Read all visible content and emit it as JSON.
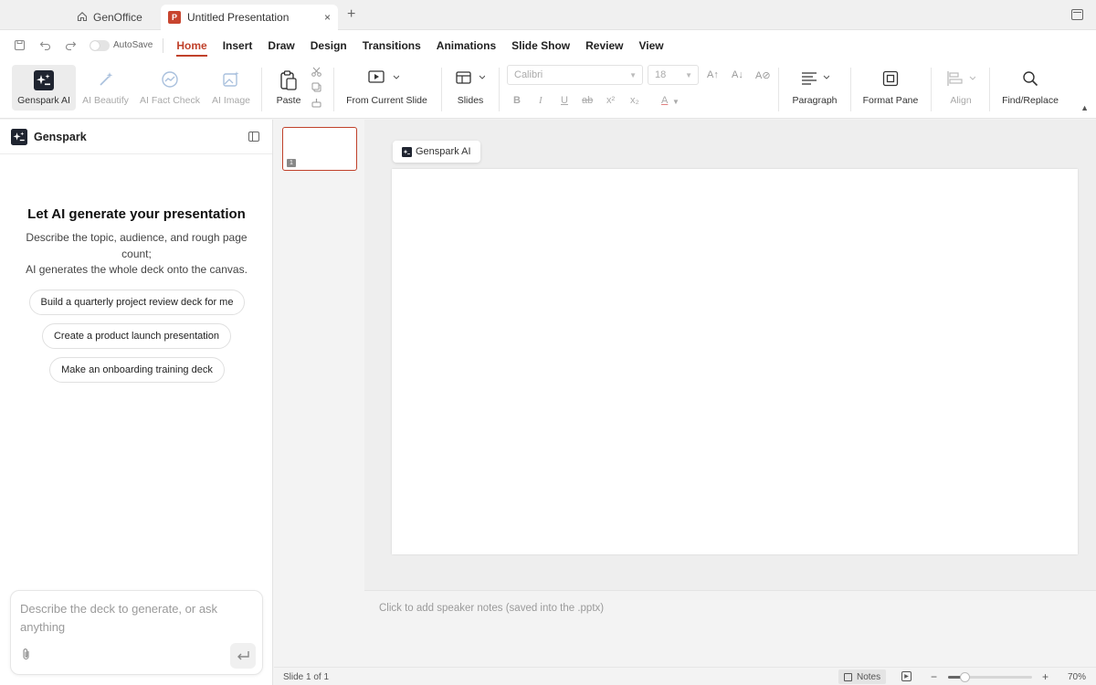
{
  "tabs": {
    "home_label": "GenOffice",
    "active_label": "Untitled Presentation",
    "active_badge": "P",
    "close_glyph": "×",
    "add_glyph": "+"
  },
  "menubar": {
    "autosave_label": "AutoSave",
    "items": [
      "Home",
      "Insert",
      "Draw",
      "Design",
      "Transitions",
      "Animations",
      "Slide Show",
      "Review",
      "View"
    ],
    "active_item": "Home"
  },
  "ribbon": {
    "genspark_ai": "Genspark AI",
    "ai_beautify": "AI Beautify",
    "ai_fact_check": "AI Fact Check",
    "ai_image": "AI Image",
    "paste": "Paste",
    "from_current_slide": "From Current Slide",
    "slides": "Slides",
    "font_name": "Calibri",
    "font_size": "18",
    "bold": "B",
    "italic": "I",
    "underline": "U",
    "strike": "ab",
    "superscript": "x²",
    "subscript": "x₂",
    "font_color": "A",
    "paragraph": "Paragraph",
    "format_pane": "Format Pane",
    "align": "Align",
    "find_replace": "Find/Replace"
  },
  "left_panel": {
    "title": "Genspark",
    "hero_title": "Let AI generate your presentation",
    "hero_desc_1": "Describe the topic, audience, and rough page count;",
    "hero_desc_2": "AI generates the whole deck onto the canvas.",
    "suggestions": [
      "Build a quarterly project review deck for me",
      "Create a product launch presentation",
      "Make an onboarding training deck"
    ],
    "composer_placeholder": "Describe the deck to generate, or ask anything"
  },
  "thumbnails": {
    "slide_number": "1"
  },
  "canvas": {
    "ai_chip_label": "Genspark AI"
  },
  "notes": {
    "placeholder": "Click to add speaker notes (saved into the .pptx)"
  },
  "statusbar": {
    "slide_info": "Slide 1 of 1",
    "notes_label": "Notes",
    "zoom_level": "70%",
    "zoom_fraction": 0.2
  },
  "colors": {
    "accent": "#c0412a",
    "ppt_badge": "#c8452f"
  },
  "icons": [
    "home-icon",
    "powerpoint-icon",
    "close-icon",
    "add-tab-icon",
    "window-icon",
    "save-icon",
    "undo-icon",
    "redo-icon",
    "genspark-icon",
    "sparkle-wand-icon",
    "fact-check-icon",
    "image-icon",
    "clipboard-icon",
    "scissors-icon",
    "copy-icon",
    "format-painter-icon",
    "slideshow-icon",
    "layout-icon",
    "paragraph-icon",
    "format-pane-icon",
    "align-icon",
    "search-icon",
    "collapse-panel-icon",
    "paperclip-icon",
    "enter-icon",
    "notes-icon",
    "play-icon"
  ]
}
